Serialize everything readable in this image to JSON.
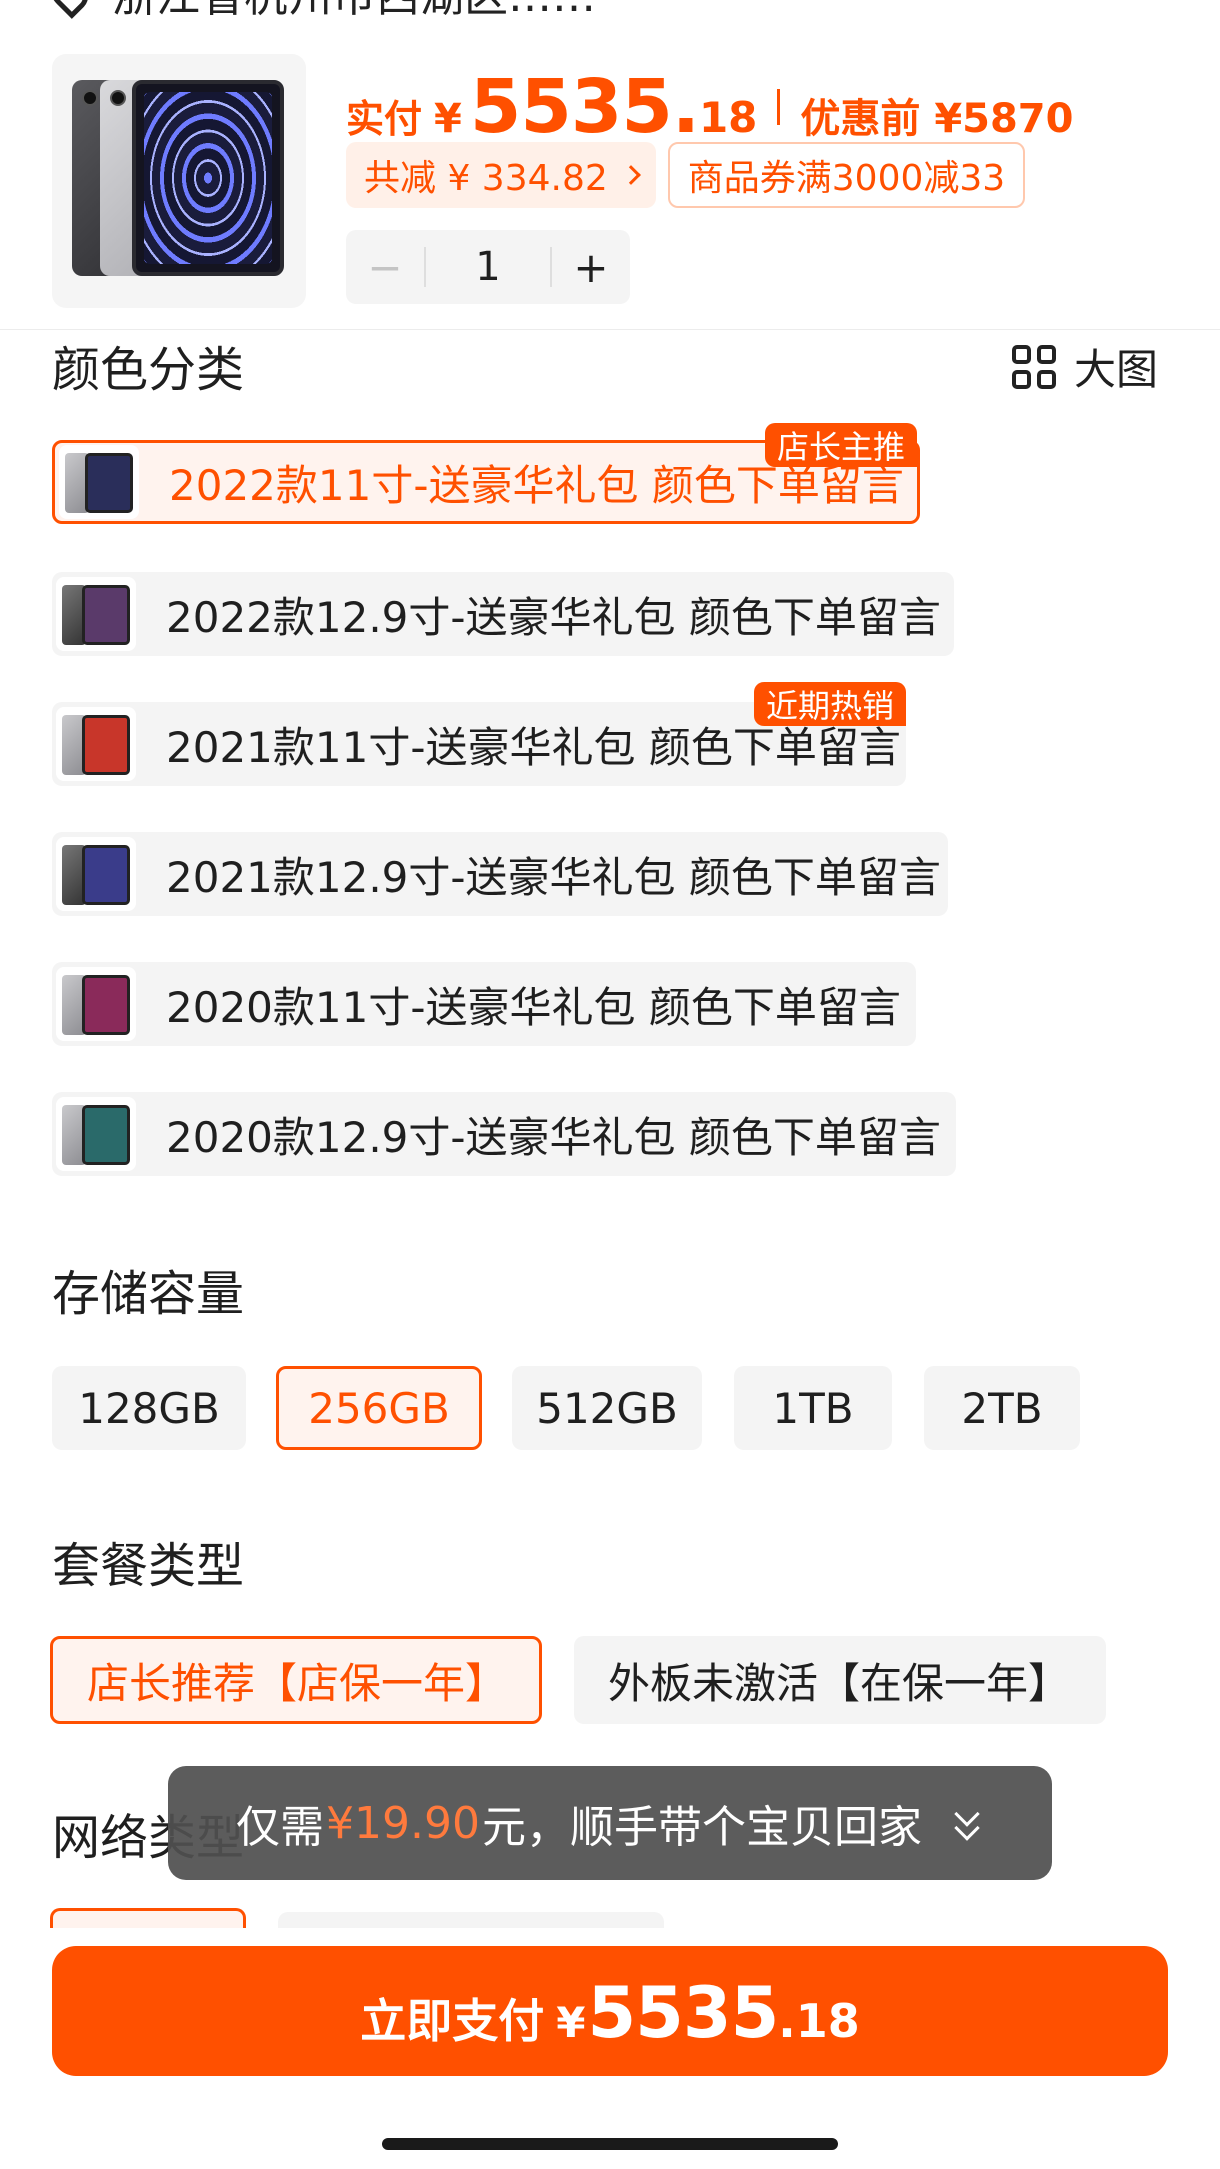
{
  "header": {
    "cut_text": "浙江省杭州市西湖区……"
  },
  "product": {
    "paid_label": "实付",
    "currency": "¥",
    "price_int": "5535.",
    "price_dec": "18",
    "before_label": "优惠前 ¥5870",
    "discount_chip": "共减 ¥ 334.82",
    "coupon_chip": "商品券满3000减33",
    "quantity": "1",
    "minus": "−",
    "plus": "+"
  },
  "color_section": {
    "title": "颜色分类",
    "big_view": "大图",
    "options": [
      {
        "label": "2022款11寸-送豪华礼包 颜色下单留言",
        "badge": "店长主推",
        "selected": true
      },
      {
        "label": "2022款12.9寸-送豪华礼包 颜色下单留言",
        "badge": "",
        "selected": false
      },
      {
        "label": "2021款11寸-送豪华礼包 颜色下单留言",
        "badge": "近期热销",
        "selected": false
      },
      {
        "label": "2021款12.9寸-送豪华礼包 颜色下单留言",
        "badge": "",
        "selected": false
      },
      {
        "label": "2020款11寸-送豪华礼包 颜色下单留言",
        "badge": "",
        "selected": false
      },
      {
        "label": "2020款12.9寸-送豪华礼包 颜色下单留言",
        "badge": "",
        "selected": false
      }
    ]
  },
  "storage_section": {
    "title": "存储容量",
    "options": [
      "128GB",
      "256GB",
      "512GB",
      "1TB",
      "2TB"
    ],
    "selected": "256GB"
  },
  "package_section": {
    "title": "套餐类型",
    "options": [
      "店长推荐【店保一年】",
      "外板未激活【在保一年】"
    ],
    "selected": "店长推荐【店保一年】"
  },
  "network_section": {
    "title": "网络类型"
  },
  "toast": {
    "prefix": "仅需",
    "amount": "¥19.90",
    "suffix": "元，顺手带个宝贝回家"
  },
  "pay_button": {
    "label": "立即支付",
    "currency": "¥",
    "int": "5535",
    "dec": ".18"
  },
  "colors": {
    "accent": "#ff5000",
    "accent_light": "#fff3ee",
    "chip_bg": "#f4f4f4"
  }
}
